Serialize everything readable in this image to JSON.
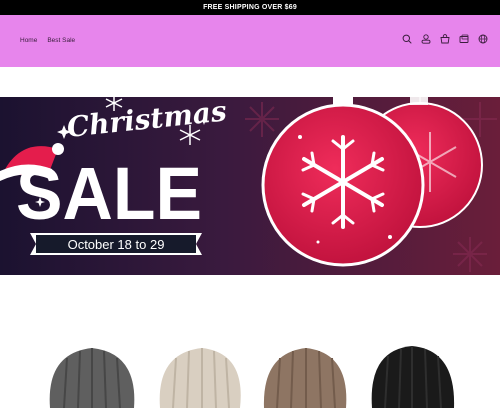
{
  "announcement": {
    "text": "FREE SHIPPING OVER $69"
  },
  "nav": {
    "items": [
      "Home",
      "Best Sale"
    ]
  },
  "header_icons": [
    "search-icon",
    "account-icon",
    "cart-icon",
    "gift-card-icon",
    "globe-icon"
  ],
  "banner": {
    "title_script": "Christmas",
    "title_big": "SALE",
    "dates": "October 18 to 29"
  },
  "products": {
    "colors": [
      "#5f5f5f",
      "#d9cfc1",
      "#8e7563",
      "#1a1a1a"
    ]
  },
  "colors": {
    "header_bg": "#e785ec",
    "announce_bg": "#000000",
    "banner_bg": "#2a1838",
    "ornament": "#e41d4c"
  }
}
